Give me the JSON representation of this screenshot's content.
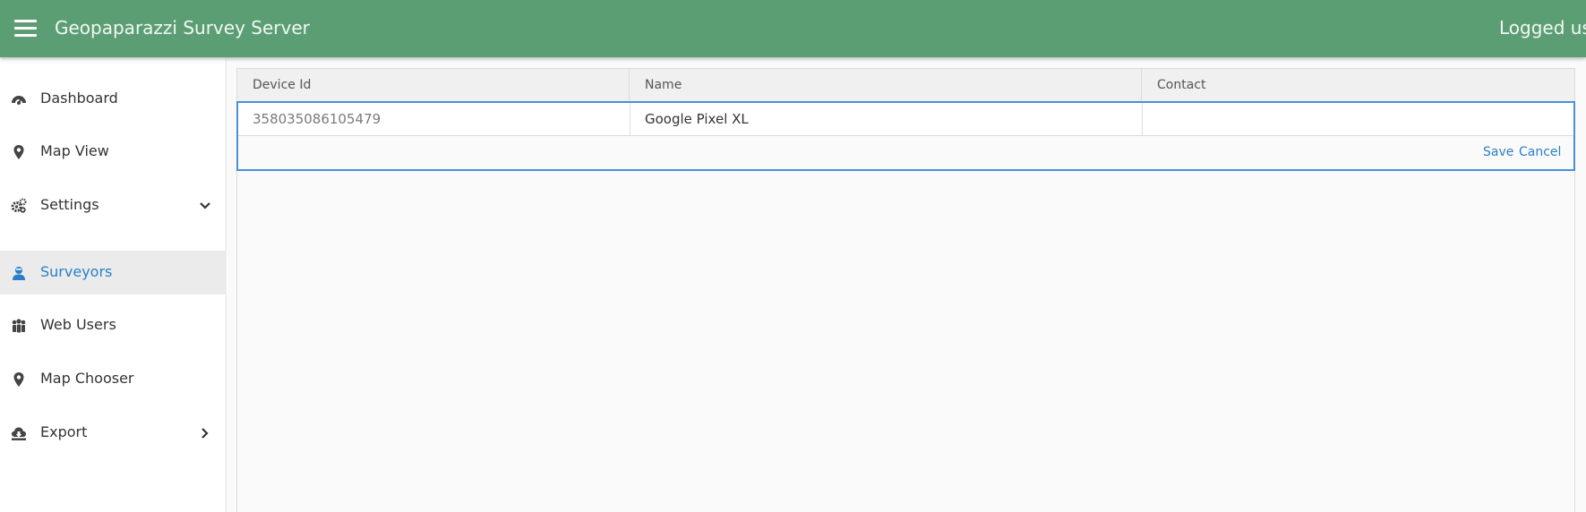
{
  "header": {
    "title": "Geopaparazzi Survey Server",
    "user_text": "Logged use",
    "menu_icon": "hamburger-menu-icon",
    "background_color": "#5c9e74"
  },
  "sidebar": {
    "items": [
      {
        "label": "Dashboard",
        "icon": "dashboard-gauge-icon",
        "active": false
      },
      {
        "label": "Map View",
        "icon": "map-marker-icon",
        "active": false
      },
      {
        "label": "Settings",
        "icon": "gears-icon",
        "active": false,
        "chevron": "chevron-down-icon"
      },
      {
        "label": "Surveyors",
        "icon": "user-icon",
        "active": true
      },
      {
        "label": "Web Users",
        "icon": "users-group-icon",
        "active": false
      },
      {
        "label": "Map Chooser",
        "icon": "map-marker-icon",
        "active": false
      },
      {
        "label": "Export",
        "icon": "download-cloud-icon",
        "active": false,
        "chevron": "chevron-right-icon"
      }
    ]
  },
  "grid": {
    "columns": [
      "Device Id",
      "Name",
      "Contact"
    ],
    "editing_row": {
      "device_id": "358035086105479",
      "name": "Google Pixel XL",
      "contact": ""
    },
    "save_label": "Save",
    "cancel_label": "Cancel"
  },
  "colors": {
    "accent": "#2a7fc8",
    "edit_border": "#4a90d9",
    "active_nav_bg": "#ebebeb"
  }
}
